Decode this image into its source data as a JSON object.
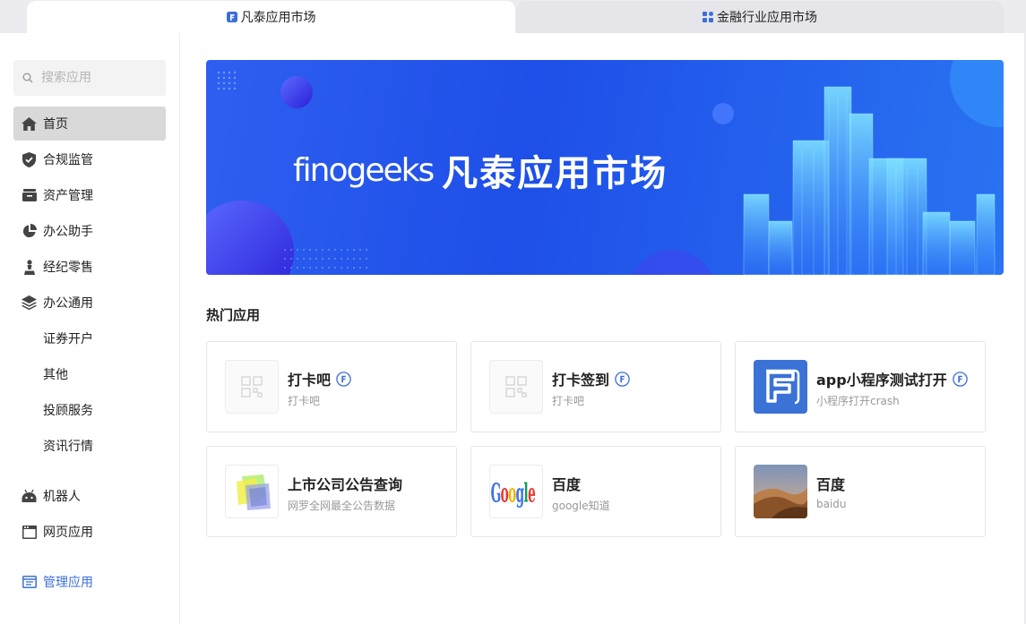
{
  "tabs": [
    {
      "label": "凡泰应用市场",
      "icon": "finogeeks-logo-icon",
      "active": true
    },
    {
      "label": "金融行业应用市场",
      "icon": "grid-apps-icon",
      "active": false
    }
  ],
  "sidebar": {
    "search_placeholder": "搜索应用",
    "items": [
      {
        "label": "首页",
        "icon": "home-icon"
      },
      {
        "label": "合规监管",
        "icon": "shield-check-icon"
      },
      {
        "label": "资产管理",
        "icon": "archive-box-icon"
      },
      {
        "label": "办公助手",
        "icon": "pie-chart-icon"
      },
      {
        "label": "经纪零售",
        "icon": "chess-pawn-icon"
      },
      {
        "label": "办公通用",
        "icon": "layers-icon"
      },
      {
        "label": "证券开户"
      },
      {
        "label": "其他"
      },
      {
        "label": "投顾服务"
      },
      {
        "label": "资讯行情"
      },
      {
        "label": "机器人",
        "icon": "robot-icon"
      },
      {
        "label": "网页应用",
        "icon": "browser-window-icon"
      },
      {
        "label": "管理应用",
        "icon": "manage-window-icon"
      }
    ]
  },
  "banner": {
    "brand": "finogeeks",
    "title": "凡泰应用市场"
  },
  "hot_apps": {
    "title": "热门应用",
    "cards": [
      {
        "name": "打卡吧",
        "desc": "打卡吧",
        "icon": "qr-placeholder-icon",
        "verified": true
      },
      {
        "name": "打卡签到",
        "desc": "打卡吧",
        "icon": "qr-placeholder-icon",
        "verified": true
      },
      {
        "name": "app小程序测试打开",
        "desc": "小程序打开crash",
        "icon": "finogeeks-f-icon",
        "verified": true
      },
      {
        "name": "上市公司公告查询",
        "desc": "网罗全网最全公告数据",
        "icon": "cube-icon",
        "verified": false
      },
      {
        "name": "百度",
        "desc": "google知道",
        "icon": "google-logo-icon",
        "verified": false
      },
      {
        "name": "百度",
        "desc": "baidu",
        "icon": "desert-dune-icon",
        "verified": false
      }
    ]
  },
  "colors": {
    "accent": "#3b6fd8",
    "banner": "#2152ea"
  }
}
